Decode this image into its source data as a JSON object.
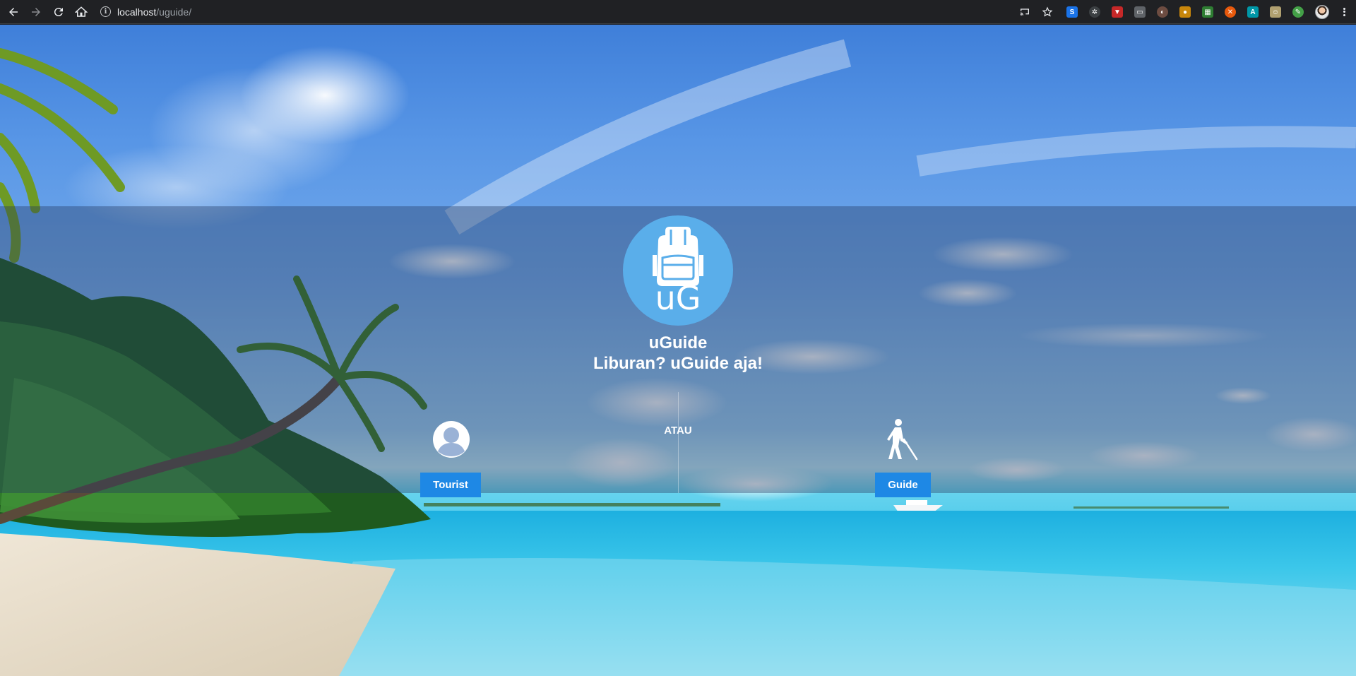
{
  "browser": {
    "url_host": "localhost",
    "url_path": "/uguide/",
    "extensions": [
      {
        "name": "s-extension-icon",
        "glyph": "S",
        "color": "#1a73e8"
      },
      {
        "name": "atom-extension-icon",
        "glyph": "✲",
        "color": "#3c4043"
      },
      {
        "name": "shield-extension-icon",
        "glyph": "▼",
        "color": "#c62828"
      },
      {
        "name": "chat-extension-icon",
        "glyph": "▭",
        "color": "#5f6368"
      },
      {
        "name": "tool-extension-icon",
        "glyph": "◐",
        "color": "#6d4c41"
      },
      {
        "name": "cookie-extension-icon",
        "glyph": "●",
        "color": "#c8860b"
      },
      {
        "name": "grid-extension-icon",
        "glyph": "▦",
        "color": "#2e7d32"
      },
      {
        "name": "close-extension-icon",
        "glyph": "✕",
        "color": "#e8590c"
      },
      {
        "name": "globe-extension-icon",
        "glyph": "A",
        "color": "#0097a7"
      },
      {
        "name": "smile-extension-icon",
        "glyph": "☺",
        "color": "#b0a070"
      },
      {
        "name": "pen-extension-icon",
        "glyph": "✎",
        "color": "#43a047"
      }
    ]
  },
  "hero": {
    "logo_text": "uG",
    "title": "uGuide",
    "tagline": "Liburan? uGuide aja!",
    "separator": "ATAU"
  },
  "roles": {
    "tourist_label": "Tourist",
    "guide_label": "Guide"
  },
  "colors": {
    "logo_bg": "#5aaeea",
    "button_bg": "#1e88e5"
  }
}
